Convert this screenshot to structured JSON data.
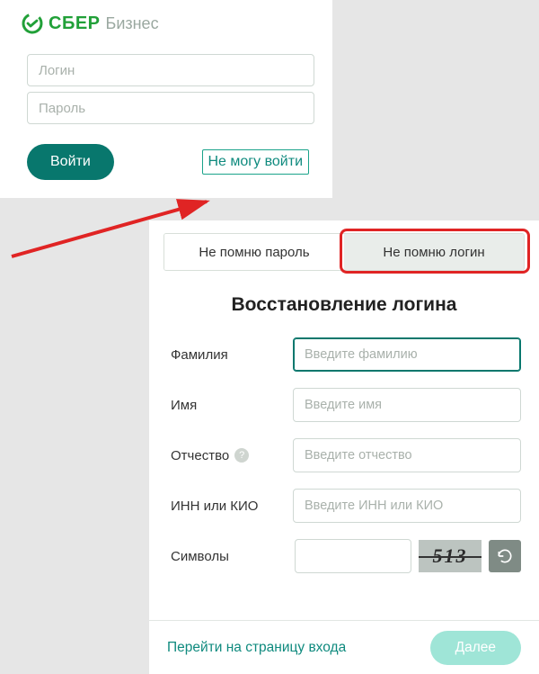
{
  "brand": {
    "main": "СБЕР",
    "sub": "Бизнес"
  },
  "login": {
    "login_placeholder": "Логин",
    "password_placeholder": "Пароль",
    "enter_label": "Войти",
    "cant_login_label": "Не могу войти"
  },
  "recover": {
    "tabs": {
      "forgot_password": "Не помню пароль",
      "forgot_login": "Не помню логин"
    },
    "title": "Восстановление логина",
    "fields": {
      "surname": {
        "label": "Фамилия",
        "placeholder": "Введите фамилию"
      },
      "name": {
        "label": "Имя",
        "placeholder": "Введите имя"
      },
      "patronymic": {
        "label": "Отчество",
        "placeholder": "Введите отчество"
      },
      "inn": {
        "label": "ИНН или КИО",
        "placeholder": "Введите ИНН или КИО"
      },
      "captcha": {
        "label": "Символы",
        "value": "513"
      }
    },
    "back_link": "Перейти на страницу входа",
    "next_label": "Далее"
  },
  "colors": {
    "accent": "#08776d",
    "brand_green": "#21a038",
    "highlight": "#e02424"
  }
}
